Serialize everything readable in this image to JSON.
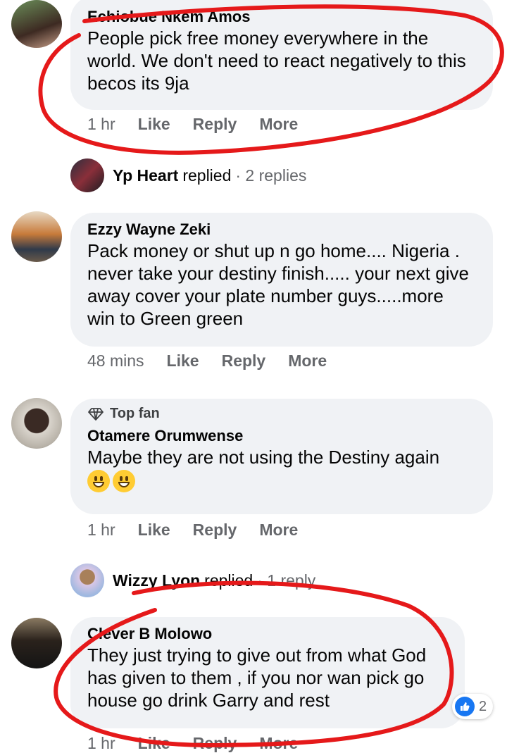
{
  "comments": [
    {
      "author": "Echiobue Nkem Amos",
      "text": "People pick free money everywhere in the world. We don't need to react negatively to this becos its 9ja",
      "time": "1 hr"
    },
    {
      "author": "Ezzy Wayne Zeki",
      "text": "Pack money or shut up n go home.... Nigeria . never take your destiny finish..... your next give away cover your plate number guys.....more win to Green green",
      "time": "48 mins"
    },
    {
      "badge": "Top fan",
      "author": "Otamere Orumwense",
      "text": "Maybe they are not using the Destiny again",
      "time": "1 hr"
    },
    {
      "author": "Clever B Molowo",
      "text": "They just trying to give out from what God has given to them , if you nor wan pick go house go drink Garry and rest",
      "time": "1 hr",
      "reaction_count": "2"
    }
  ],
  "replies": [
    {
      "name": "Yp Heart",
      "verb": "replied",
      "count": "· 2 replies"
    },
    {
      "name": "Wizzy Lyon",
      "verb": "replied",
      "count": "· 1 reply"
    }
  ],
  "actions": {
    "like": "Like",
    "reply": "Reply",
    "more": "More"
  },
  "colors": {
    "annotation": "#e5191a",
    "bubble": "#f0f2f5",
    "like_blue": "#1877f2"
  }
}
